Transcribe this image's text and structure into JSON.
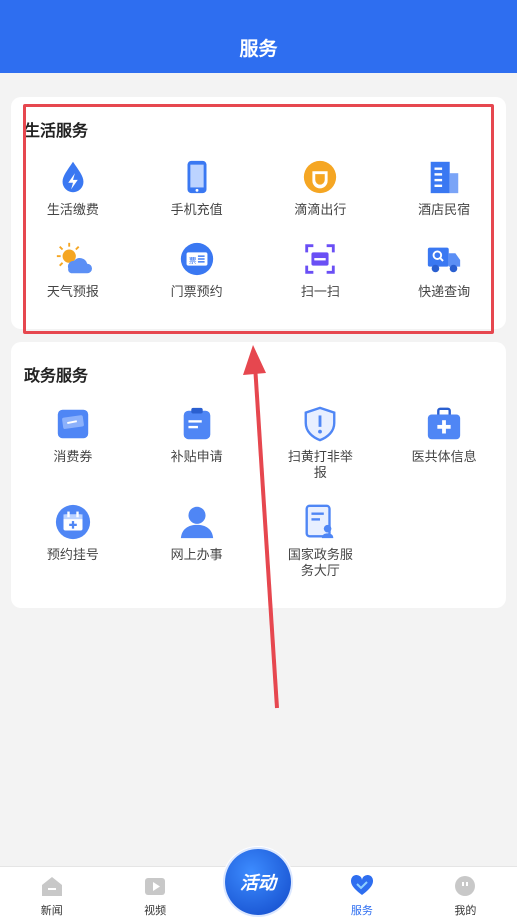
{
  "header": {
    "title": "服务"
  },
  "life_services": {
    "title": "生活服务",
    "items": [
      {
        "label": "生活缴费",
        "icon": "water-drop-bolt-icon"
      },
      {
        "label": "手机充值",
        "icon": "phone-icon"
      },
      {
        "label": "滴滴出行",
        "icon": "didi-icon"
      },
      {
        "label": "酒店民宿",
        "icon": "hotel-building-icon"
      },
      {
        "label": "天气预报",
        "icon": "weather-icon"
      },
      {
        "label": "门票预约",
        "icon": "ticket-icon"
      },
      {
        "label": "扫一扫",
        "icon": "scan-icon"
      },
      {
        "label": "快递查询",
        "icon": "delivery-truck-icon"
      }
    ]
  },
  "gov_services": {
    "title": "政务服务",
    "items": [
      {
        "label": "消费券",
        "icon": "coupon-icon"
      },
      {
        "label": "补贴申请",
        "icon": "clipboard-icon"
      },
      {
        "label": "扫黄打非举报",
        "icon": "shield-alert-icon"
      },
      {
        "label": "医共体信息",
        "icon": "medical-kit-icon"
      },
      {
        "label": "预约挂号",
        "icon": "calendar-plus-icon"
      },
      {
        "label": "网上办事",
        "icon": "person-icon"
      },
      {
        "label": "国家政务服务大厅",
        "icon": "document-person-icon"
      }
    ]
  },
  "tabbar": {
    "tabs": [
      {
        "label": "新闻",
        "icon": "home-icon"
      },
      {
        "label": "视频",
        "icon": "video-icon"
      },
      {
        "label": "服务",
        "icon": "heart-icon"
      },
      {
        "label": "我的",
        "icon": "face-icon"
      }
    ],
    "center_label": "活动"
  },
  "colors": {
    "header_bg": "#2e6ef0",
    "accent": "#2e6ef0",
    "highlight": "#e6474f"
  }
}
